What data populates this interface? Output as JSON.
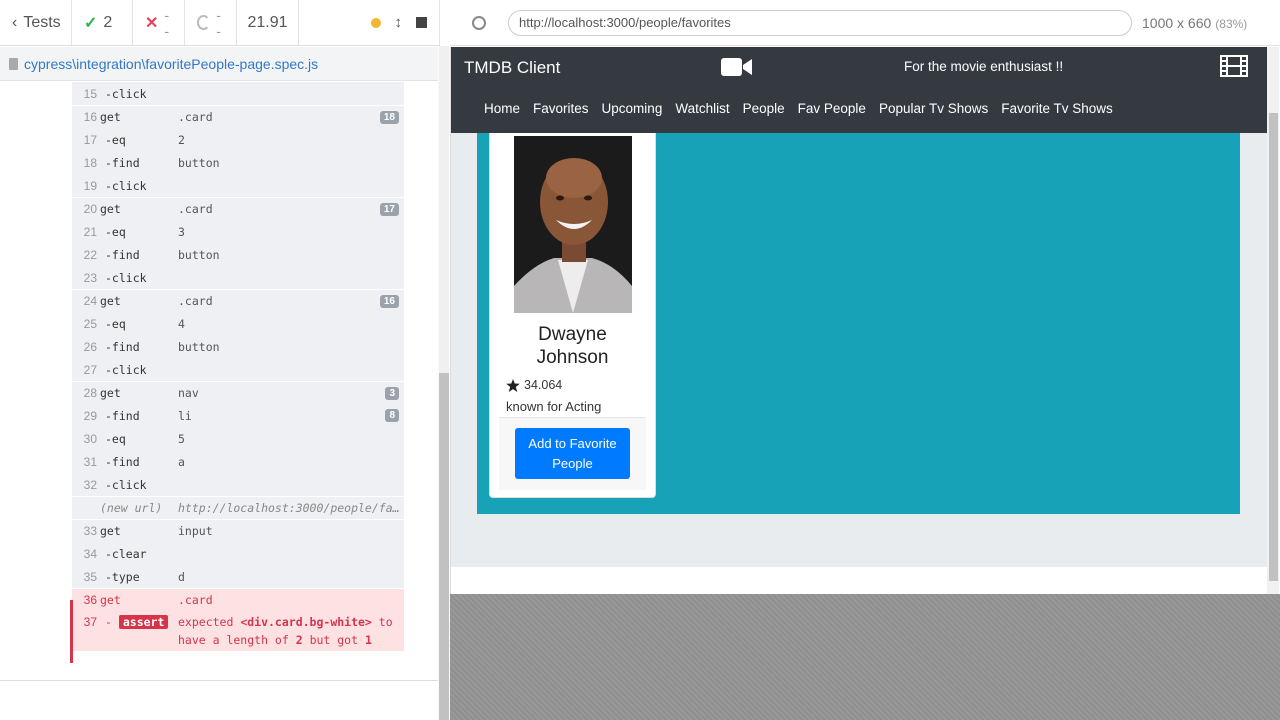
{
  "runner": {
    "tests_label": "Tests",
    "passed": "2",
    "failed": "--",
    "pending": "--",
    "duration": "21.91",
    "spec_path": "cypress\\integration\\favoritePeople-page.spec.js"
  },
  "commands": [
    {
      "num": "15",
      "name": "-click",
      "msg": "",
      "child": true
    },
    {
      "num": "16",
      "name": "get",
      "msg": ".card",
      "badge": "18",
      "sep": true
    },
    {
      "num": "17",
      "name": "-eq",
      "msg": "2",
      "child": true
    },
    {
      "num": "18",
      "name": "-find",
      "msg": "button",
      "child": true
    },
    {
      "num": "19",
      "name": "-click",
      "msg": "",
      "child": true
    },
    {
      "num": "20",
      "name": "get",
      "msg": ".card",
      "badge": "17",
      "sep": true
    },
    {
      "num": "21",
      "name": "-eq",
      "msg": "3",
      "child": true
    },
    {
      "num": "22",
      "name": "-find",
      "msg": "button",
      "child": true
    },
    {
      "num": "23",
      "name": "-click",
      "msg": "",
      "child": true
    },
    {
      "num": "24",
      "name": "get",
      "msg": ".card",
      "badge": "16",
      "sep": true
    },
    {
      "num": "25",
      "name": "-eq",
      "msg": "4",
      "child": true
    },
    {
      "num": "26",
      "name": "-find",
      "msg": "button",
      "child": true
    },
    {
      "num": "27",
      "name": "-click",
      "msg": "",
      "child": true
    },
    {
      "num": "28",
      "name": "get",
      "msg": "nav",
      "badge": "3",
      "sep": true
    },
    {
      "num": "29",
      "name": "-find",
      "msg": "li",
      "badge": "8",
      "child": true
    },
    {
      "num": "30",
      "name": "-eq",
      "msg": "5",
      "child": true
    },
    {
      "num": "31",
      "name": "-find",
      "msg": "a",
      "child": true
    },
    {
      "num": "32",
      "name": "-click",
      "msg": "",
      "child": true
    },
    {
      "num": "",
      "name": "(new url)",
      "msg": "http://localhost:3000/people/fav…",
      "newurl": true,
      "sep": true
    },
    {
      "num": "33",
      "name": "get",
      "msg": "input",
      "sep": true
    },
    {
      "num": "34",
      "name": "-clear",
      "msg": "",
      "child": true
    },
    {
      "num": "35",
      "name": "-type",
      "msg": "d",
      "child": true
    },
    {
      "num": "36",
      "name": "get",
      "msg": ".card",
      "err": true,
      "sep": true
    }
  ],
  "assert": {
    "num": "37",
    "badge": "assert",
    "line1_pre": "expected ",
    "line1_code": "<div.card.bg-white>",
    "line1_post": " to",
    "line2_pre": "have a length of ",
    "line2_a": "2",
    "line2_mid": " but got ",
    "line2_b": "1"
  },
  "aut": {
    "url": "http://localhost:3000/people/favorites",
    "viewport": "1000 x 660",
    "scale": "(83%)"
  },
  "app": {
    "brand": "TMDB Client",
    "tagline": "For the movie enthusiast !!",
    "nav": [
      "Home",
      "Favorites",
      "Upcoming",
      "Watchlist",
      "People",
      "Fav People",
      "Popular Tv Shows",
      "Favorite Tv Shows"
    ],
    "person": {
      "name": "Dwayne Johnson",
      "rating": "34.064",
      "known_for": "known for Acting",
      "button": "Add to Favorite People"
    }
  },
  "colors": {
    "navbar": "#343a40",
    "teal": "#17a2b8",
    "primary_button": "#007bff",
    "error": "#d6344b",
    "passed": "#2fb34a"
  }
}
